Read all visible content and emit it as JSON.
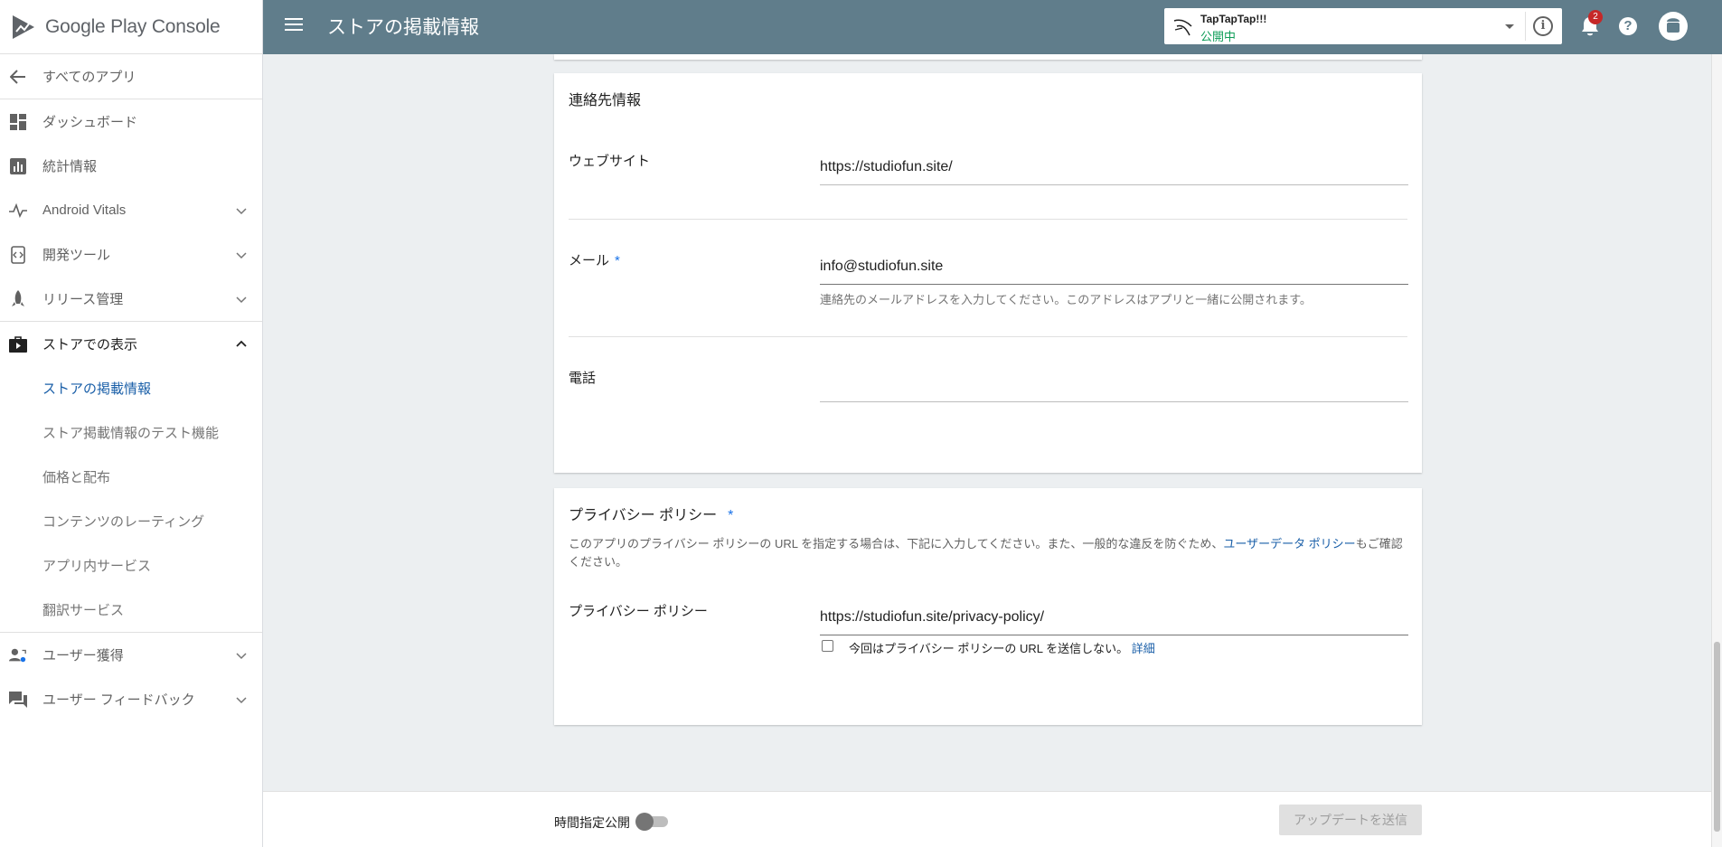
{
  "brand": {
    "name_part1": "Google Play",
    "name_part2": "Console"
  },
  "sidebar": {
    "back": {
      "label": "すべてのアプリ",
      "icon": "arrow-left-icon"
    },
    "items": [
      {
        "label": "ダッシュボード",
        "icon": "dashboard-icon",
        "expandable": false
      },
      {
        "label": "統計情報",
        "icon": "bar-chart-icon",
        "expandable": false
      },
      {
        "label": "Android Vitals",
        "icon": "pulse-icon",
        "expandable": true
      },
      {
        "label": "開発ツール",
        "icon": "dev-tools-icon",
        "expandable": true
      },
      {
        "label": "リリース管理",
        "icon": "rocket-icon",
        "expandable": true
      },
      {
        "label": "ストアでの表示",
        "icon": "store-bag-icon",
        "expandable": true,
        "expanded": true
      }
    ],
    "store_sub_items": [
      {
        "label": "ストアの掲載情報",
        "selected": true
      },
      {
        "label": "ストア掲載情報のテスト機能",
        "selected": false
      },
      {
        "label": "価格と配布",
        "selected": false
      },
      {
        "label": "コンテンツのレーティング",
        "selected": false
      },
      {
        "label": "アプリ内サービス",
        "selected": false
      },
      {
        "label": "翻訳サービス",
        "selected": false
      }
    ],
    "bottom_items": [
      {
        "label": "ユーザー獲得",
        "icon": "user-acquisition-icon",
        "expandable": true
      },
      {
        "label": "ユーザー フィードバック",
        "icon": "feedback-icon",
        "expandable": true
      }
    ]
  },
  "header": {
    "title": "ストアの掲載情報",
    "app": {
      "name": "TapTapTap!!!",
      "status": "公開中"
    },
    "notifications_count": "2",
    "help_glyph": "?",
    "info_glyph": "i"
  },
  "contact": {
    "title": "連絡先情報",
    "website": {
      "label": "ウェブサイト",
      "value": "https://studiofun.site/"
    },
    "email": {
      "label": "メール",
      "required_mark": "*",
      "value": "info@studiofun.site",
      "hint": "連絡先のメールアドレスを入力してください。このアドレスはアプリと一緒に公開されます。"
    },
    "phone": {
      "label": "電話",
      "value": ""
    }
  },
  "privacy": {
    "title": "プライバシー ポリシー",
    "required_mark": "*",
    "desc_before": "このアプリのプライバシー ポリシーの URL を指定する場合は、下記に入力してください。また、一般的な違反を防ぐため、",
    "desc_link": "ユーザーデータ ポリシー",
    "desc_after": "もご確認ください。",
    "field_label": "プライバシー ポリシー",
    "value": "https://studiofun.site/privacy-policy/",
    "checkbox_label": "今回はプライバシー ポリシーの URL を送信しない。",
    "details_link": "詳細"
  },
  "footer": {
    "scheduled_label": "時間指定公開",
    "submit_label": "アップデートを送信"
  },
  "colors": {
    "topbar": "#607d8b",
    "link": "#1a5fa8",
    "published": "#0f9d58",
    "badge": "#c62828"
  }
}
